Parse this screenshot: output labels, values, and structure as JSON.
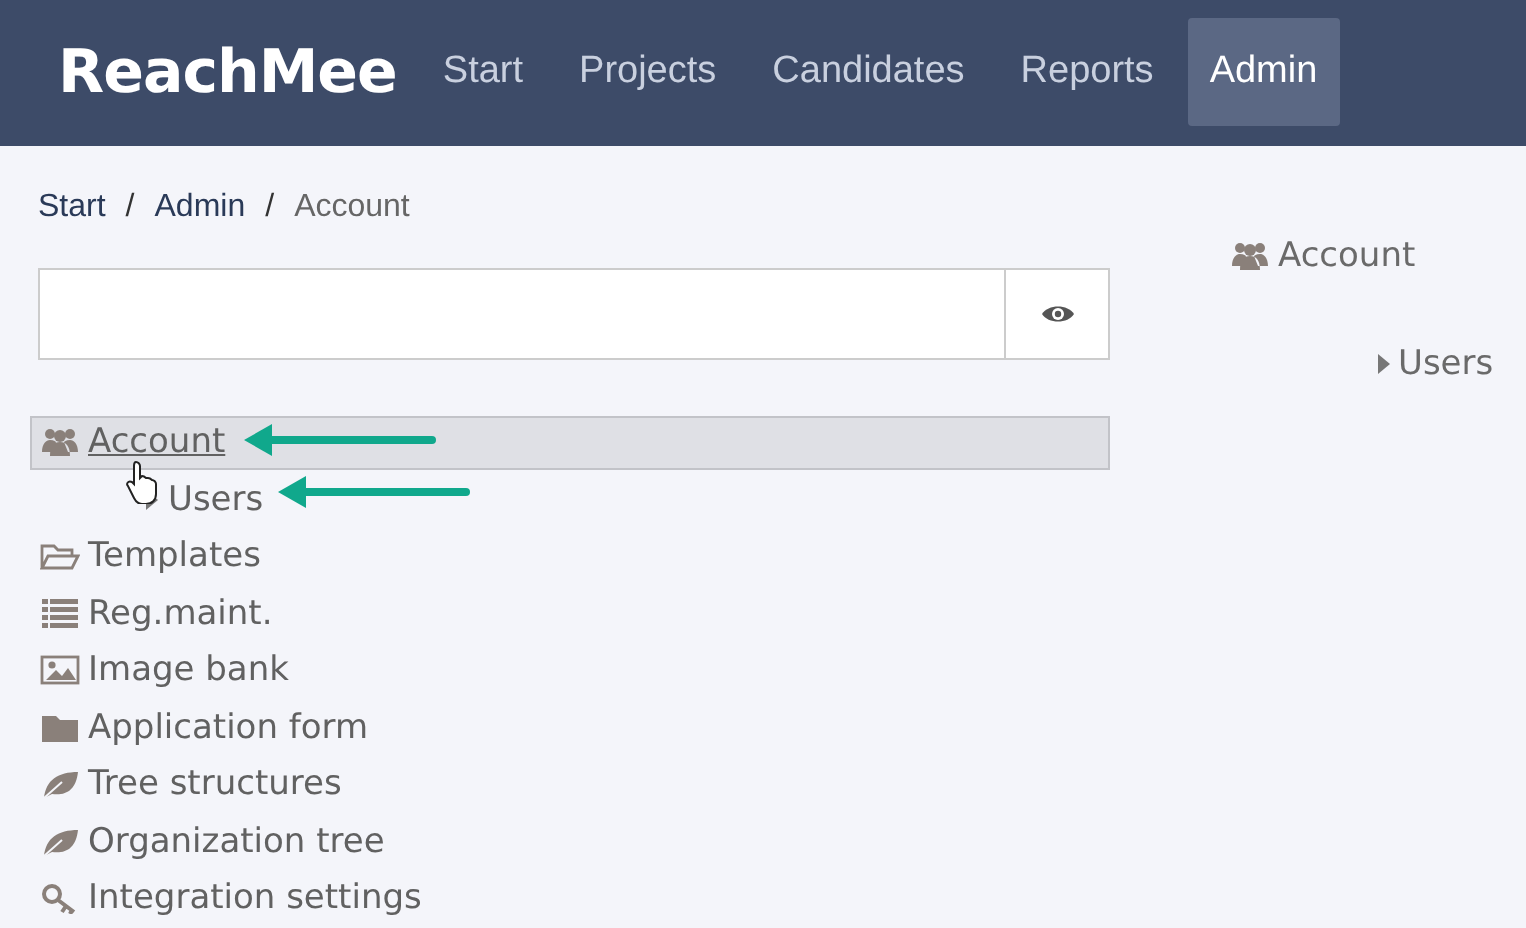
{
  "header": {
    "logo": "ReachMee",
    "nav": [
      {
        "label": "Start",
        "selected": false
      },
      {
        "label": "Projects",
        "selected": false
      },
      {
        "label": "Candidates",
        "selected": false
      },
      {
        "label": "Reports",
        "selected": false
      },
      {
        "label": "Admin",
        "selected": true
      }
    ]
  },
  "breadcrumb": [
    {
      "label": "Start",
      "separator": "/"
    },
    {
      "label": "Admin",
      "separator": "/"
    },
    {
      "label": "Account"
    }
  ],
  "tree": [
    {
      "label": "Account",
      "kind": "group",
      "selected": true,
      "children": [
        {
          "label": "Users",
          "selected": false,
          "expanded": false
        }
      ]
    },
    {
      "label": "Templates",
      "kind": "folder-open",
      "selected": false
    },
    {
      "label": "Reg.maint.",
      "kind": "list",
      "selected": false
    },
    {
      "label": "Image bank",
      "kind": "image",
      "selected": false
    },
    {
      "label": "Application form",
      "kind": "folder",
      "selected": false
    },
    {
      "label": "Tree structures",
      "kind": "leaf",
      "selected": false
    },
    {
      "label": "Organization tree",
      "kind": "leaf",
      "selected": false
    },
    {
      "label": "Integration settings",
      "kind": "key",
      "selected": false
    }
  ],
  "detail": {
    "title": "Account",
    "items": [
      {
        "label": "Users",
        "expanded": false
      }
    ]
  }
}
